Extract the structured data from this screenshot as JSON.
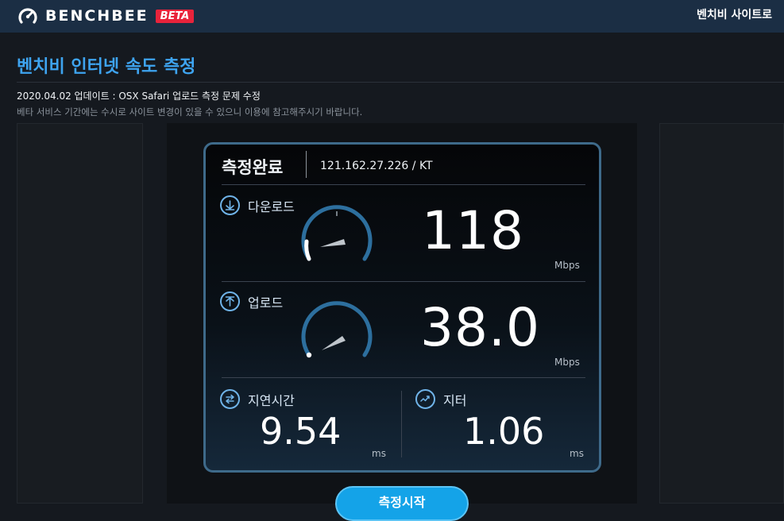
{
  "header": {
    "logo_text": "BENCHBEE",
    "beta_badge": "BETA",
    "site_link": "벤치비 사이트로"
  },
  "page": {
    "title": "벤치비 인터넷 속도 측정",
    "notice_update": "2020.04.02 업데이트 : OSX Safari 업로드 측정 문제 수정",
    "notice_beta": "베타 서비스 기간에는 수시로 사이트 변경이 있을 수 있으니 이용에 참고해주시기 바랍니다."
  },
  "result": {
    "status": "측정완료",
    "ip_isp": "121.162.27.226 / KT",
    "download": {
      "label": "다운로드",
      "value": "118",
      "unit": "Mbps"
    },
    "upload": {
      "label": "업로드",
      "value": "38.0",
      "unit": "Mbps"
    },
    "latency": {
      "label": "지연시간",
      "value": "9.54",
      "unit": "ms"
    },
    "jitter": {
      "label": "지터",
      "value": "1.06",
      "unit": "ms"
    }
  },
  "actions": {
    "start_label": "측정시작"
  },
  "colors": {
    "accent": "#3ea4f0",
    "header_bg": "#1b2e44",
    "beta_red": "#e8233b",
    "button_blue": "#14a3e8",
    "gauge_blue": "#2d6f9e"
  },
  "icons": {
    "logo": "speedometer-icon",
    "download": "arrow-down-circle-icon",
    "upload": "arrow-up-circle-icon",
    "latency": "swap-arrows-icon",
    "jitter": "pulse-icon"
  }
}
